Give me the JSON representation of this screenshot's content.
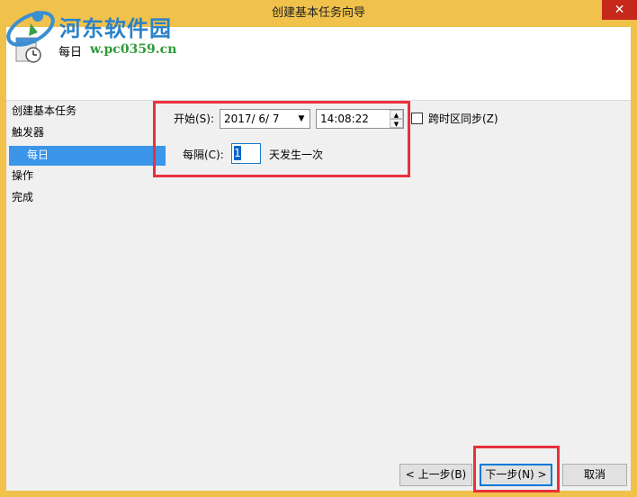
{
  "window": {
    "title": "创建基本任务向导",
    "close_glyph": "✕"
  },
  "header": {
    "step_title": "每日"
  },
  "watermark": {
    "title": "河东软件园",
    "url": "w.pc0359.cn"
  },
  "nav": {
    "items": [
      {
        "label": "创建基本任务"
      },
      {
        "label": "触发器"
      },
      {
        "label": "每日"
      },
      {
        "label": "操作"
      },
      {
        "label": "完成"
      }
    ],
    "selected": "每日"
  },
  "form": {
    "start_label": "开始(S):",
    "start_date": "2017/  6/  7",
    "start_time": "14:08:22",
    "sync_label": "跨时区同步(Z)",
    "sync_checked": false,
    "every_label": "每隔(C):",
    "every_value": "1",
    "every_suffix": "天发生一次"
  },
  "buttons": {
    "back": "< 上一步(B)",
    "next": "下一步(N) >",
    "cancel": "取消"
  },
  "colors": {
    "titlebar": "#f0c14b",
    "selection": "#3b95e8",
    "highlight_box": "#e8313c",
    "close": "#c7281c"
  }
}
